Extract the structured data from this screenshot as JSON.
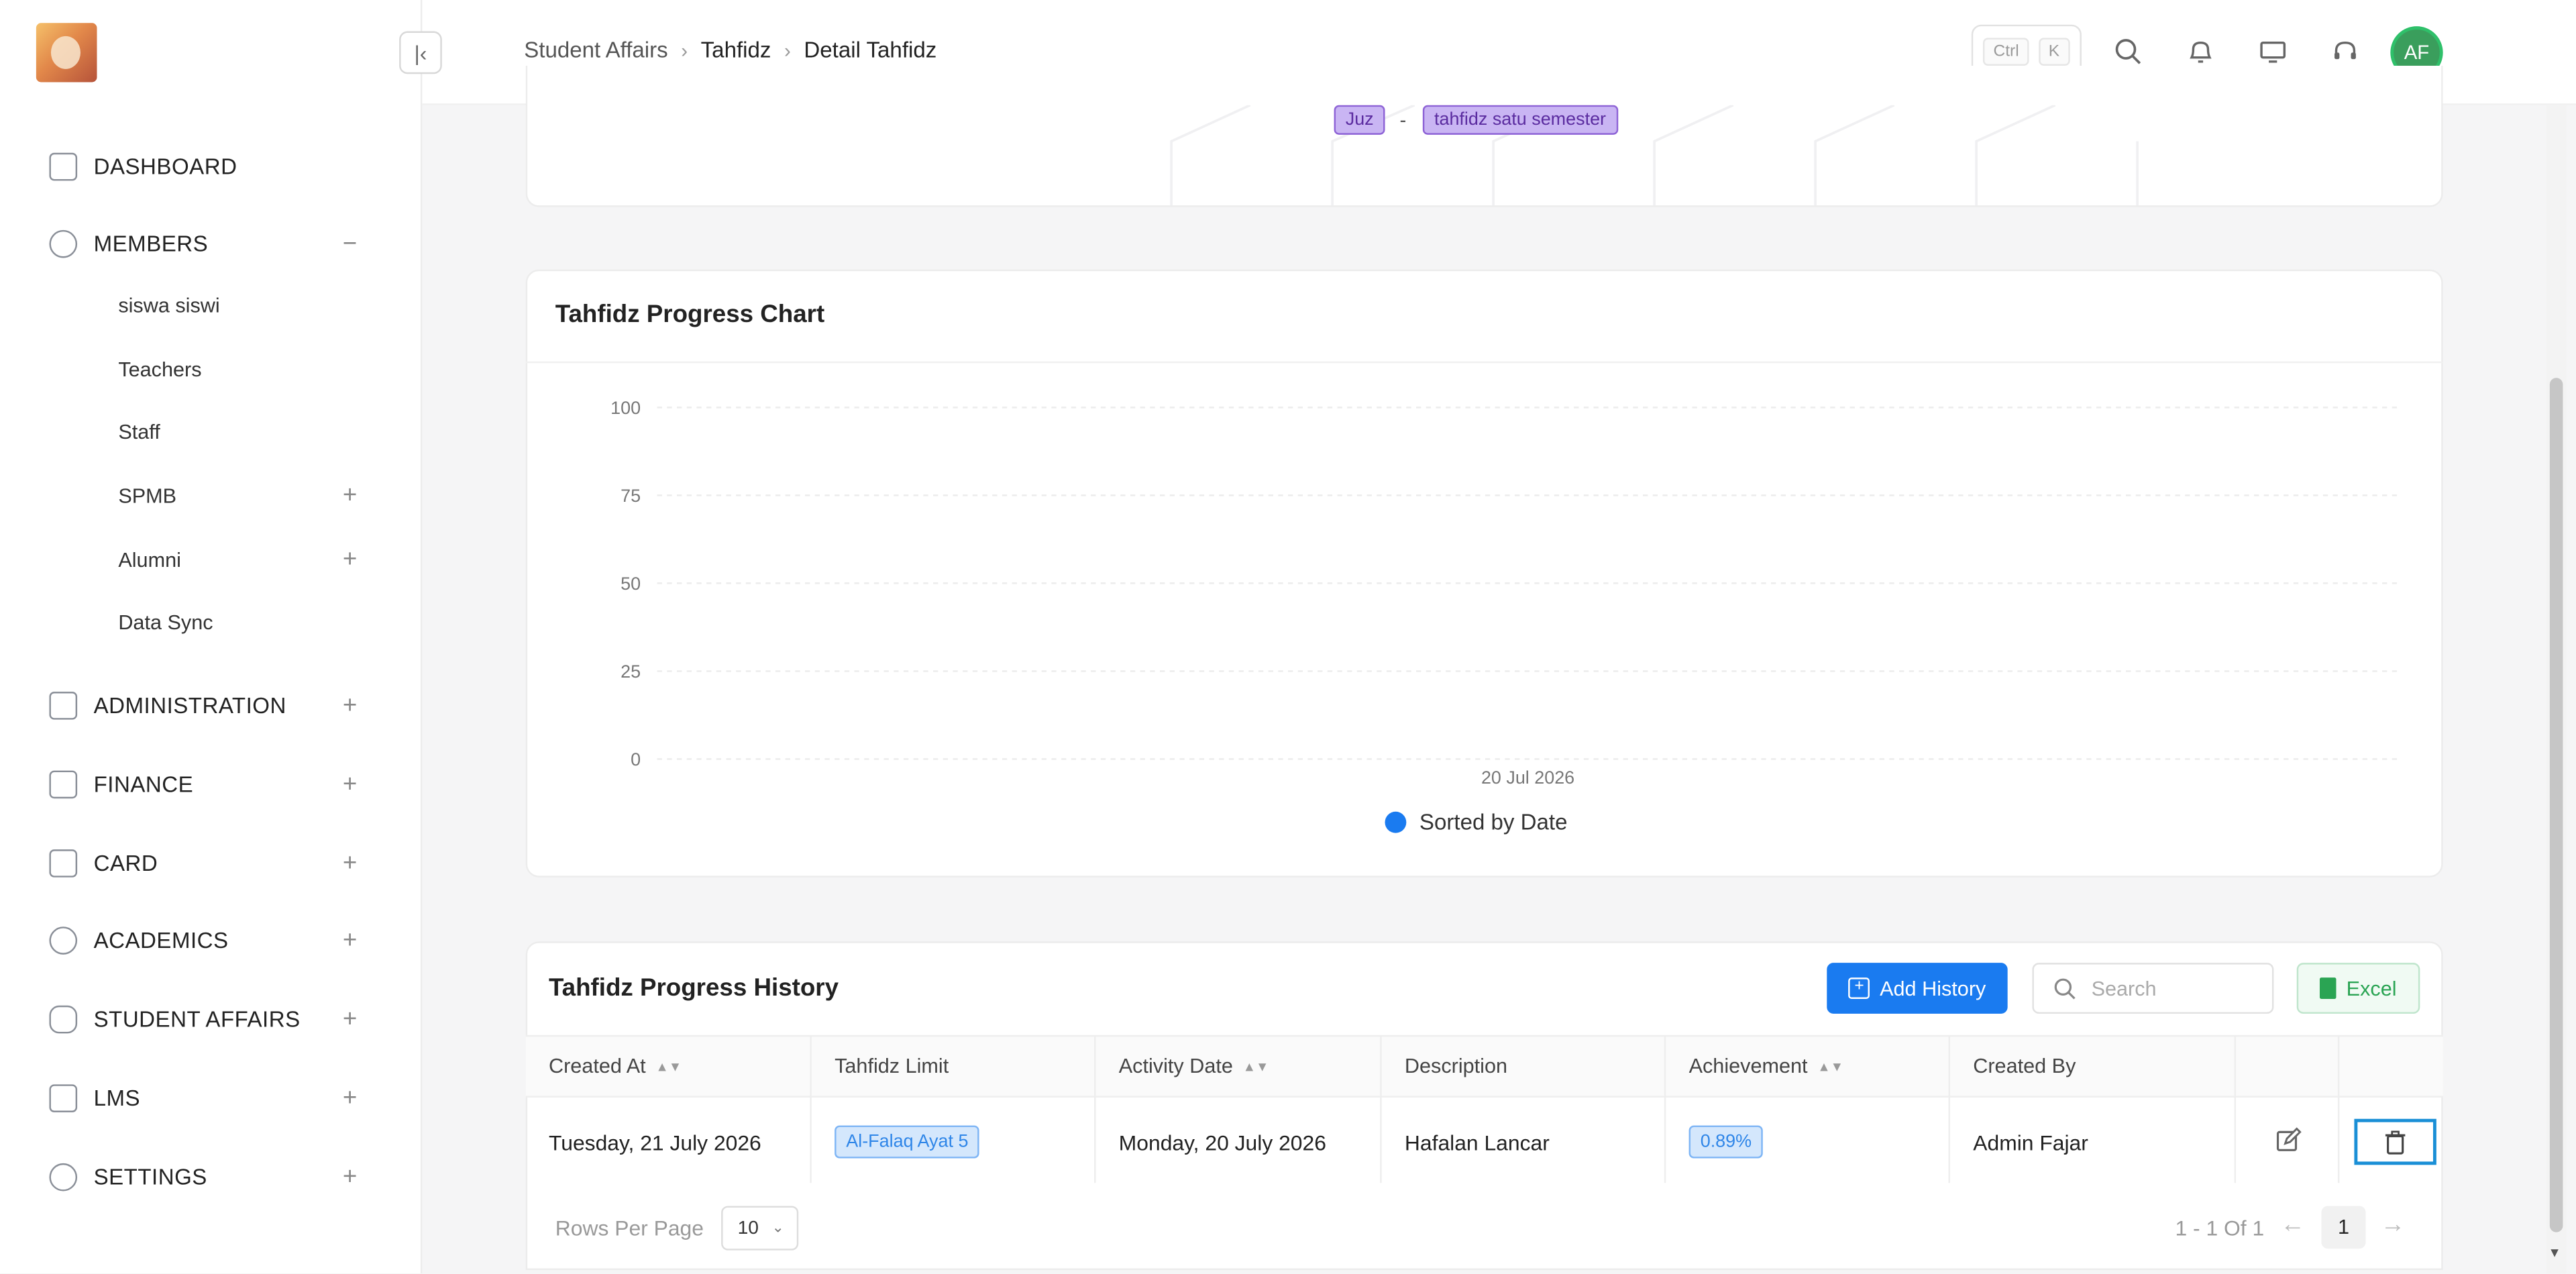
{
  "sidebar": {
    "items": [
      {
        "label": "DASHBOARD",
        "icon": "dashboard-icon",
        "toggle": ""
      },
      {
        "label": "MEMBERS",
        "icon": "members-icon",
        "toggle": "−"
      },
      {
        "label": "ADMINISTRATION",
        "icon": "folder-icon",
        "toggle": "+"
      },
      {
        "label": "FINANCE",
        "icon": "finance-icon",
        "toggle": "+"
      },
      {
        "label": "CARD",
        "icon": "card-icon",
        "toggle": "+"
      },
      {
        "label": "ACADEMICS",
        "icon": "academics-icon",
        "toggle": "+"
      },
      {
        "label": "STUDENT AFFAIRS",
        "icon": "student-affairs-icon",
        "toggle": "+"
      },
      {
        "label": "LMS",
        "icon": "lms-icon",
        "toggle": "+"
      },
      {
        "label": "SETTINGS",
        "icon": "gear-icon",
        "toggle": "+"
      }
    ],
    "members_sub": [
      {
        "label": "siswa siswi",
        "toggle": ""
      },
      {
        "label": "Teachers",
        "toggle": ""
      },
      {
        "label": "Staff",
        "toggle": ""
      },
      {
        "label": "SPMB",
        "toggle": "+"
      },
      {
        "label": "Alumni",
        "toggle": "+"
      },
      {
        "label": "Data Sync",
        "toggle": ""
      }
    ]
  },
  "topbar": {
    "breadcrumb": [
      "Student Affairs",
      "Tahfidz",
      "Detail Tahfidz"
    ],
    "shortcut": [
      "Ctrl",
      "K"
    ],
    "avatar_initials": "AF"
  },
  "info": {
    "tag_juz": "Juz",
    "dash": "-",
    "tag_semester": "tahfidz satu semester"
  },
  "chart": {
    "title": "Tahfidz Progress Chart",
    "legend": "Sorted by Date",
    "legend_color": "#1a7bf0"
  },
  "chart_data": {
    "type": "line",
    "title": "Tahfidz Progress Chart",
    "x": [
      "20 Jul 2026"
    ],
    "series": [
      {
        "name": "Sorted by Date",
        "values": []
      }
    ],
    "ylim": [
      0,
      100
    ],
    "yticks": [
      0,
      25,
      50,
      75,
      100
    ],
    "xlabel": "",
    "ylabel": "",
    "grid": true,
    "legend": "bottom"
  },
  "history": {
    "title": "Tahfidz Progress History",
    "add_label": "Add History",
    "search_placeholder": "Search",
    "excel_label": "Excel",
    "columns": [
      "Created At",
      "Tahfidz Limit",
      "Activity Date",
      "Description",
      "Achievement",
      "Created By"
    ],
    "rows": [
      {
        "created_at": "Tuesday, 21 July 2026",
        "limit": "Al-Falaq Ayat 5",
        "activity_date": "Monday, 20 July 2026",
        "description": "Hafalan Lancar",
        "achievement": "0.89%",
        "created_by": "Admin Fajar"
      }
    ],
    "rows_per_page_label": "Rows Per Page",
    "rows_per_page": "10",
    "range": "1 - 1 Of 1",
    "page": "1",
    "prev": "←",
    "next": "→"
  }
}
